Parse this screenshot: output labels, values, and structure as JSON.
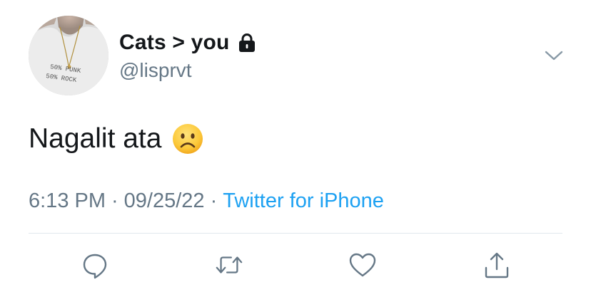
{
  "author": {
    "display_name": "Cats > you",
    "handle": "@lisprvt",
    "avatar_shirt_text": [
      "50% PUNK",
      "50% ROCK"
    ],
    "protected_icon": "lock-icon"
  },
  "tweet": {
    "text": "Nagalit ata",
    "emoji": "frowning-face-emoji"
  },
  "meta": {
    "time": "6:13 PM",
    "date": "09/25/22",
    "separator": "·",
    "source": "Twitter for iPhone"
  },
  "actions": {
    "reply_icon": "reply-icon",
    "retweet_icon": "retweet-icon",
    "like_icon": "heart-icon",
    "share_icon": "share-icon"
  },
  "colors": {
    "text_primary": "#14171a",
    "text_secondary": "#657786",
    "link": "#1da1f2",
    "divider": "#e1e8ed"
  }
}
